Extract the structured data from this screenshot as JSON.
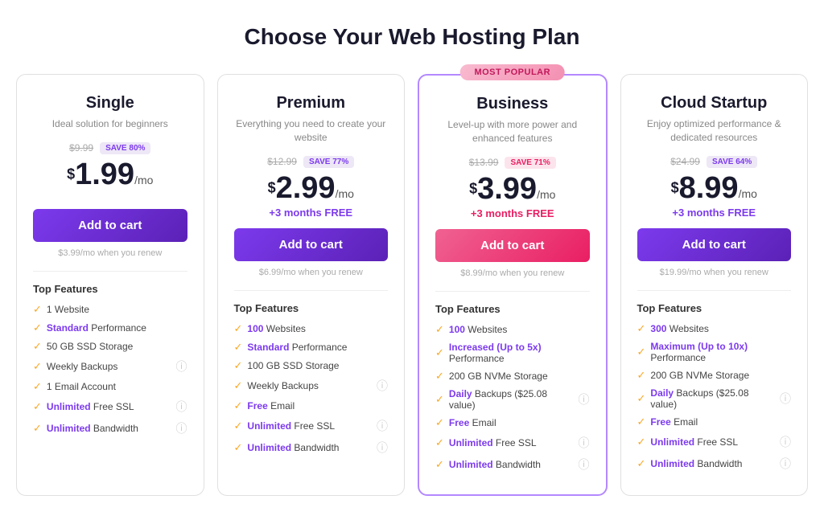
{
  "page": {
    "title": "Choose Your Web Hosting Plan"
  },
  "plans": [
    {
      "id": "single",
      "name": "Single",
      "desc": "Ideal solution for beginners",
      "original_price": "$9.99",
      "save_label": "SAVE 80%",
      "save_style": "purple",
      "amount": "1.99",
      "free_months": null,
      "btn_label": "Add to cart",
      "btn_style": "purple",
      "renew_note": "$3.99/mo when you renew",
      "popular": false,
      "features": [
        {
          "text": "1 Website",
          "bold": null,
          "has_info": false
        },
        {
          "text": "Standard Performance",
          "bold": "Standard",
          "has_info": false
        },
        {
          "text": "50 GB SSD Storage",
          "bold": null,
          "has_info": false
        },
        {
          "text": "Weekly Backups",
          "bold": null,
          "has_info": true
        },
        {
          "text": "1 Email Account",
          "bold": null,
          "has_info": false
        },
        {
          "text": "Unlimited Free SSL",
          "bold": "Unlimited",
          "has_info": true
        },
        {
          "text": "Unlimited Bandwidth",
          "bold": "Unlimited",
          "has_info": true
        }
      ]
    },
    {
      "id": "premium",
      "name": "Premium",
      "desc": "Everything you need to create your website",
      "original_price": "$12.99",
      "save_label": "SAVE 77%",
      "save_style": "purple",
      "amount": "2.99",
      "free_months": "+3 months FREE",
      "free_months_style": "purple",
      "btn_label": "Add to cart",
      "btn_style": "purple",
      "renew_note": "$6.99/mo when you renew",
      "popular": false,
      "features": [
        {
          "text": "100 Websites",
          "bold": "100",
          "has_info": false
        },
        {
          "text": "Standard Performance",
          "bold": "Standard",
          "has_info": false
        },
        {
          "text": "100 GB SSD Storage",
          "bold": null,
          "has_info": false
        },
        {
          "text": "Weekly Backups",
          "bold": null,
          "has_info": true
        },
        {
          "text": "Free Email",
          "bold": "Free",
          "has_info": false
        },
        {
          "text": "Unlimited Free SSL",
          "bold": "Unlimited",
          "has_info": true
        },
        {
          "text": "Unlimited Bandwidth",
          "bold": "Unlimited",
          "has_info": true
        }
      ]
    },
    {
      "id": "business",
      "name": "Business",
      "desc": "Level-up with more power and enhanced features",
      "original_price": "$13.99",
      "save_label": "SAVE 71%",
      "save_style": "pink",
      "amount": "3.99",
      "free_months": "+3 months FREE",
      "free_months_style": "pink",
      "btn_label": "Add to cart",
      "btn_style": "pink",
      "renew_note": "$8.99/mo when you renew",
      "popular": true,
      "popular_badge": "MOST POPULAR",
      "features": [
        {
          "text": "100 Websites",
          "bold": "100",
          "has_info": false
        },
        {
          "text": "Increased (Up to 5x) Performance",
          "bold": "Increased (Up to 5x)",
          "has_info": false
        },
        {
          "text": "200 GB NVMe Storage",
          "bold": null,
          "has_info": false
        },
        {
          "text": "Daily Backups ($25.08 value)",
          "bold": "Daily",
          "has_info": true
        },
        {
          "text": "Free Email",
          "bold": "Free",
          "has_info": false
        },
        {
          "text": "Unlimited Free SSL",
          "bold": "Unlimited",
          "has_info": true
        },
        {
          "text": "Unlimited Bandwidth",
          "bold": "Unlimited",
          "has_info": true
        }
      ]
    },
    {
      "id": "cloud-startup",
      "name": "Cloud Startup",
      "desc": "Enjoy optimized performance & dedicated resources",
      "original_price": "$24.99",
      "save_label": "SAVE 64%",
      "save_style": "purple",
      "amount": "8.99",
      "free_months": "+3 months FREE",
      "free_months_style": "purple",
      "btn_label": "Add to cart",
      "btn_style": "purple",
      "renew_note": "$19.99/mo when you renew",
      "popular": false,
      "features": [
        {
          "text": "300 Websites",
          "bold": "300",
          "has_info": false
        },
        {
          "text": "Maximum (Up to 10x) Performance",
          "bold": "Maximum (Up to 10x)",
          "has_info": false
        },
        {
          "text": "200 GB NVMe Storage",
          "bold": null,
          "has_info": false
        },
        {
          "text": "Daily Backups ($25.08 value)",
          "bold": "Daily",
          "has_info": true
        },
        {
          "text": "Free Email",
          "bold": "Free",
          "has_info": false
        },
        {
          "text": "Unlimited Free SSL",
          "bold": "Unlimited",
          "has_info": true
        },
        {
          "text": "Unlimited Bandwidth",
          "bold": "Unlimited",
          "has_info": true
        }
      ]
    }
  ]
}
